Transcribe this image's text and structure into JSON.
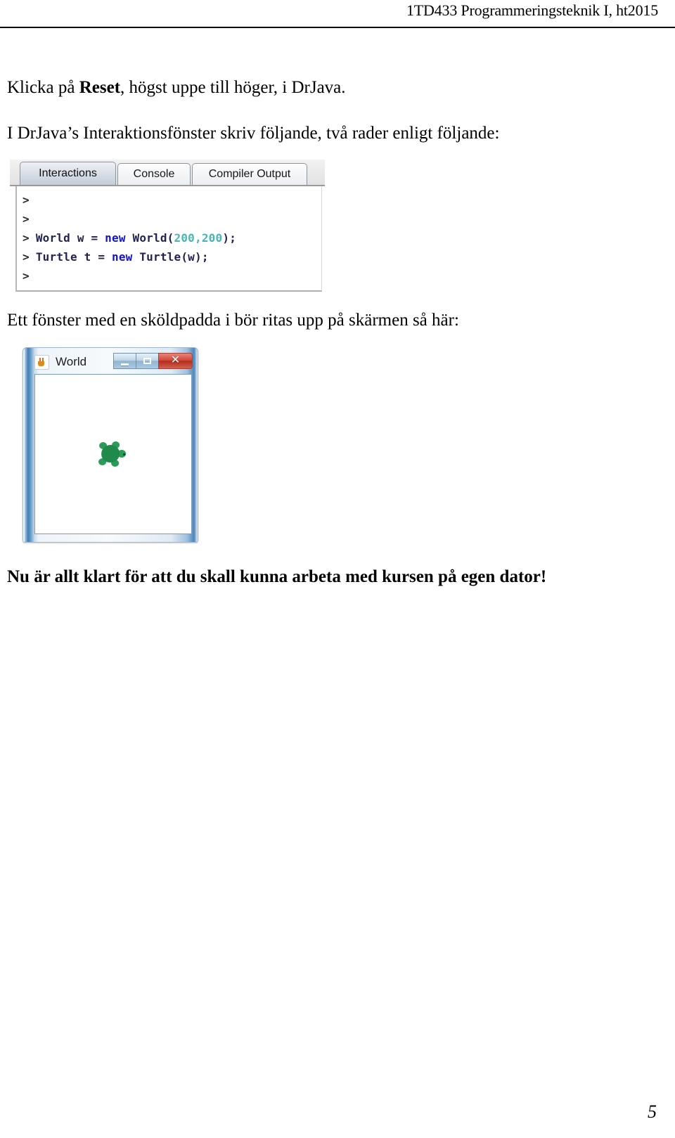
{
  "header": {
    "course_text": "1TD433 Programmeringsteknik I, ht2015"
  },
  "body": {
    "line1_before": "Klicka på ",
    "line1_bold": "Reset",
    "line1_after": ", högst uppe till höger, i DrJava.",
    "line2": "I DrJava’s Interaktionsfönster skriv följande, två rader enligt följande:",
    "line3": "Ett fönster med en sköldpadda i bör ritas upp på skärmen så här:",
    "line4": "Nu är allt klart för att du skall kunna arbeta med kursen på egen dator!"
  },
  "drjava": {
    "tabs": [
      {
        "label": "Interactions",
        "active": true
      },
      {
        "label": "Console",
        "active": false
      },
      {
        "label": "Compiler Output",
        "active": false
      }
    ],
    "prompt": ">",
    "lines": [
      {
        "prompt": ">",
        "text": ""
      },
      {
        "prompt": ">",
        "text": ""
      },
      {
        "prompt": ">",
        "pre": "World w = ",
        "kw": "new",
        "mid": " World(",
        "num": "200,200",
        "post": ");"
      },
      {
        "prompt": ">",
        "pre": "Turtle t = ",
        "kw": "new",
        "mid": " Turtle(w",
        "num": "",
        "post": ");"
      },
      {
        "prompt": ">",
        "text": ""
      }
    ],
    "line3_full": "> World w = new World(200,200);",
    "line4_full": "> Turtle t = new Turtle(w);",
    "colors": {
      "keyword": "#1414c8",
      "number": "#46b6b6",
      "identifier": "#23234f"
    }
  },
  "world_window": {
    "title": "World",
    "icon": "java-cup-icon",
    "buttons": {
      "minimize": "minimize-button",
      "maximize": "maximize-button",
      "close": "✕"
    },
    "canvas": {
      "turtle_color": "#1f8a4c",
      "background": "#ffffff"
    }
  },
  "footer": {
    "page_number": "5"
  }
}
